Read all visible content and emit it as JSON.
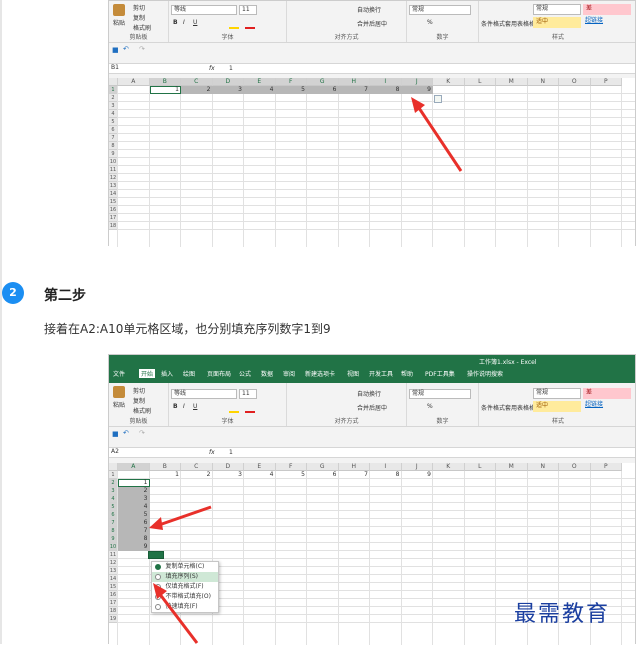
{
  "top_excel": {
    "ribbon": {
      "clipboard": {
        "paste": "粘贴",
        "cut": "剪切",
        "copy": "复制",
        "format_painter": "格式刷",
        "group_label": "剪贴板"
      },
      "font": {
        "font_name": "等线",
        "font_size": "11",
        "group_label": "字体",
        "bold": "B",
        "italic": "I",
        "underline": "U"
      },
      "alignment": {
        "wrap_text": "自动换行",
        "merge_center": "合并后居中",
        "group_label": "对齐方式"
      },
      "number": {
        "format": "常规",
        "group_label": "数字",
        "percent": "%"
      },
      "styles": {
        "conditional": "条件格式",
        "table_format": "套用表格格式",
        "style_normal": "常规",
        "style_bad": "差",
        "style_neutral": "适中",
        "style_hyperlink": "超链接",
        "group_label": "样式"
      }
    },
    "name_box": "B1",
    "formula_value": "1",
    "fx": "fx",
    "columns": [
      "A",
      "B",
      "C",
      "D",
      "E",
      "F",
      "G",
      "H",
      "I",
      "J",
      "K",
      "L",
      "M",
      "N",
      "O",
      "P"
    ],
    "rows": [
      "1",
      "2",
      "3",
      "4",
      "5",
      "6",
      "7",
      "8",
      "9",
      "10",
      "11",
      "12",
      "13",
      "14",
      "15",
      "16",
      "17",
      "18"
    ],
    "row1_values": [
      "1",
      "2",
      "3",
      "4",
      "5",
      "6",
      "7",
      "8",
      "9"
    ]
  },
  "step": {
    "number": "2",
    "title": "第二步",
    "description": "接着在A2:A10单元格区域，也分别填充序列数字1到9"
  },
  "bottom_excel": {
    "title_bar": "工作簿1.xlsx  -  Excel",
    "tabs": [
      "文件",
      "开始",
      "插入",
      "绘图",
      "页面布局",
      "公式",
      "数据",
      "审阅",
      "新建选项卡",
      "视图",
      "开发工具",
      "帮助",
      "PDF工具集",
      "操作说明搜索"
    ],
    "ribbon": {
      "clipboard": {
        "paste": "粘贴",
        "cut": "剪切",
        "copy": "复制",
        "format_painter": "格式刷",
        "group_label": "剪贴板"
      },
      "font": {
        "font_name": "等线",
        "font_size": "11",
        "group_label": "字体",
        "bold": "B",
        "italic": "I",
        "underline": "U"
      },
      "alignment": {
        "wrap_text": "自动换行",
        "merge_center": "合并后居中",
        "group_label": "对齐方式"
      },
      "number": {
        "format": "常规",
        "group_label": "数字",
        "percent": "%"
      },
      "styles": {
        "conditional": "条件格式",
        "table_format": "套用表格格式",
        "style_normal": "常规",
        "style_bad": "差",
        "style_neutral": "适中",
        "style_hyperlink": "超链接",
        "group_label": "样式"
      }
    },
    "name_box": "A2",
    "formula_value": "1",
    "fx": "fx",
    "columns": [
      "A",
      "B",
      "C",
      "D",
      "E",
      "F",
      "G",
      "H",
      "I",
      "J",
      "K",
      "L",
      "M",
      "N",
      "O",
      "P"
    ],
    "rows": [
      "1",
      "2",
      "3",
      "4",
      "5",
      "6",
      "7",
      "8",
      "9",
      "10",
      "11",
      "12",
      "13",
      "14",
      "15",
      "16",
      "17",
      "18",
      "19"
    ],
    "row1_values": [
      "1",
      "2",
      "3",
      "4",
      "5",
      "6",
      "7",
      "8",
      "9"
    ],
    "col_a_values": [
      "1",
      "2",
      "3",
      "4",
      "5",
      "6",
      "7",
      "8",
      "9"
    ],
    "autofill_menu": [
      "复制单元格(C)",
      "填充序列(S)",
      "仅填充格式(F)",
      "不带格式填充(O)",
      "快速填充(F)"
    ]
  },
  "watermark": "最需教育",
  "colors": {
    "excel_green": "#217346",
    "step_blue": "#1b8ef2",
    "arrow_red": "#e8302a",
    "selection_gray": "#b7b7b7"
  }
}
